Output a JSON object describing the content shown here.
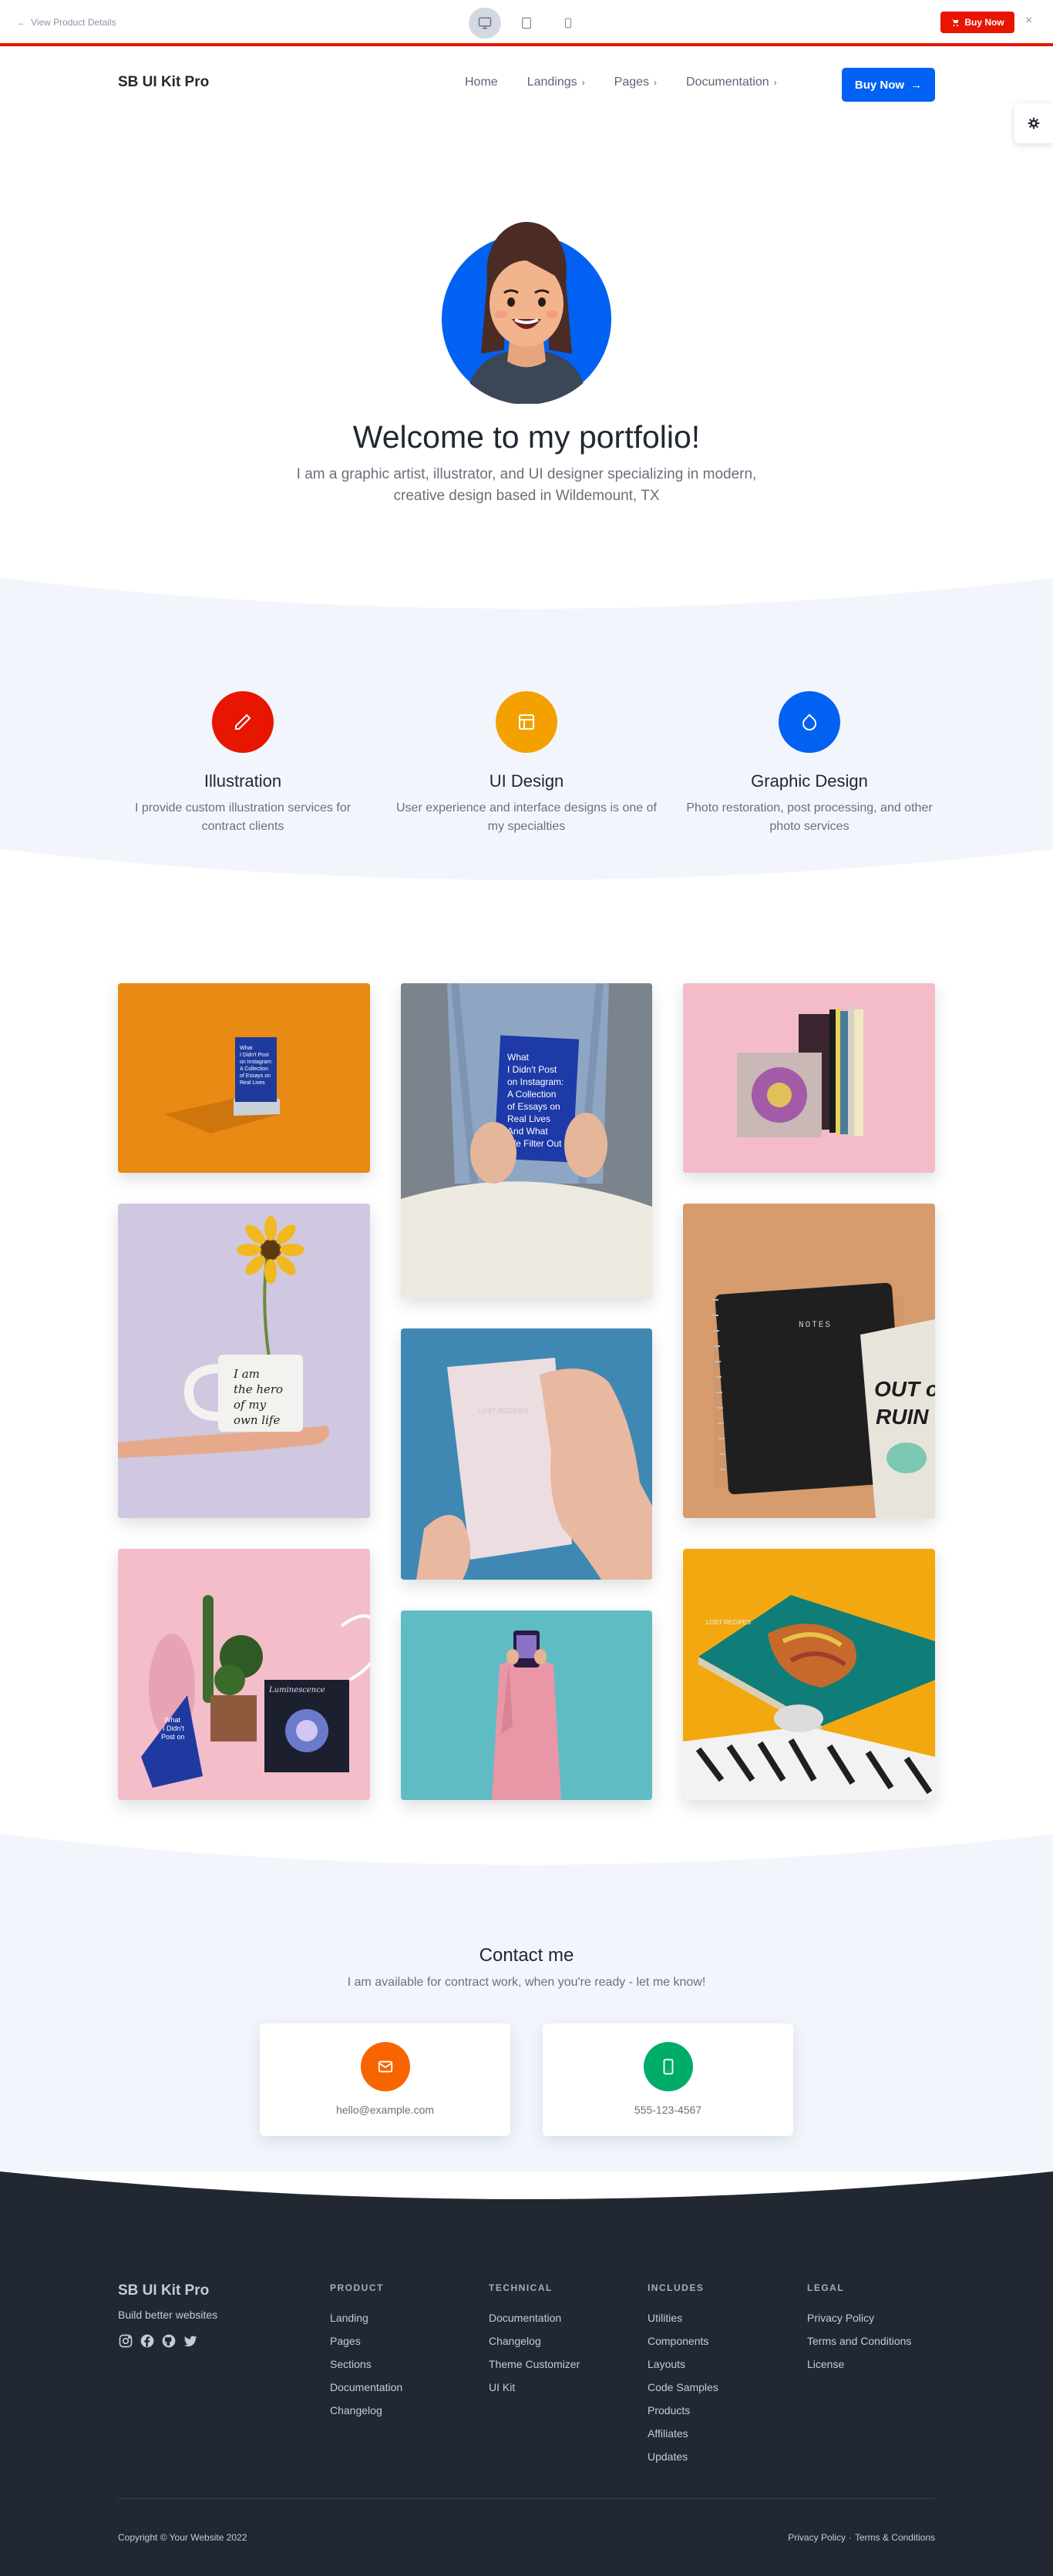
{
  "preview_bar": {
    "back_label": "View Product Details",
    "buy_label": "Buy Now",
    "close_glyph": "×",
    "devices": [
      {
        "name": "desktop-icon",
        "active": true
      },
      {
        "name": "tablet-icon",
        "active": false
      },
      {
        "name": "mobile-icon",
        "active": false
      }
    ]
  },
  "nav": {
    "brand": "SB UI Kit Pro",
    "links": [
      {
        "label": "Home",
        "dropdown": false
      },
      {
        "label": "Landings",
        "dropdown": true
      },
      {
        "label": "Pages",
        "dropdown": true
      },
      {
        "label": "Documentation",
        "dropdown": true
      }
    ],
    "buy_label": "Buy Now"
  },
  "hero": {
    "title": "Welcome to my portfolio!",
    "subtitle": "I am a graphic artist, illustrator, and UI designer specializing in modern, creative design based in Wildemount, TX"
  },
  "services": [
    {
      "title": "Illustration",
      "description": "I provide custom illustration services for contract clients",
      "color": "#e81500",
      "icon": "pencil-icon"
    },
    {
      "title": "UI Design",
      "description": "User experience and interface designs is one of my specialties",
      "color": "#f4a100",
      "icon": "layout-icon"
    },
    {
      "title": "Graphic Design",
      "description": "Photo restoration, post processing, and other photo services",
      "color": "#0061f2",
      "icon": "droplet-icon"
    }
  ],
  "gallery": {
    "book_title": "What I Didn't Post on Instagram: A Collection of Essays on Real Lives And What We Filter Out",
    "mug_text": "I am the hero of my own life",
    "notebook_label": "NOTES",
    "booklet_title": "OUT of RUIN",
    "card_script": "Luminescence",
    "book_cover_script": "Lost Recipes"
  },
  "contact": {
    "title": "Contact me",
    "subtitle": "I am available for contract work, when you're ready - let me know!",
    "email": "hello@example.com",
    "phone": "555-123-4567",
    "email_color": "#f76400",
    "phone_color": "#00ac69"
  },
  "footer": {
    "brand": "SB UI Kit Pro",
    "tagline": "Build better websites",
    "social": [
      "instagram-icon",
      "facebook-icon",
      "github-icon",
      "twitter-icon"
    ],
    "columns": [
      {
        "heading": "PRODUCT",
        "items": [
          "Landing",
          "Pages",
          "Sections",
          "Documentation",
          "Changelog"
        ]
      },
      {
        "heading": "TECHNICAL",
        "items": [
          "Documentation",
          "Changelog",
          "Theme Customizer",
          "UI Kit"
        ]
      },
      {
        "heading": "INCLUDES",
        "items": [
          "Utilities",
          "Components",
          "Layouts",
          "Code Samples",
          "Products",
          "Affiliates",
          "Updates"
        ]
      },
      {
        "heading": "LEGAL",
        "items": [
          "Privacy Policy",
          "Terms and Conditions",
          "License"
        ]
      }
    ],
    "copyright": "Copyright © Your Website 2022",
    "legal_links": [
      "Privacy Policy",
      "·",
      "Terms & Conditions"
    ]
  }
}
